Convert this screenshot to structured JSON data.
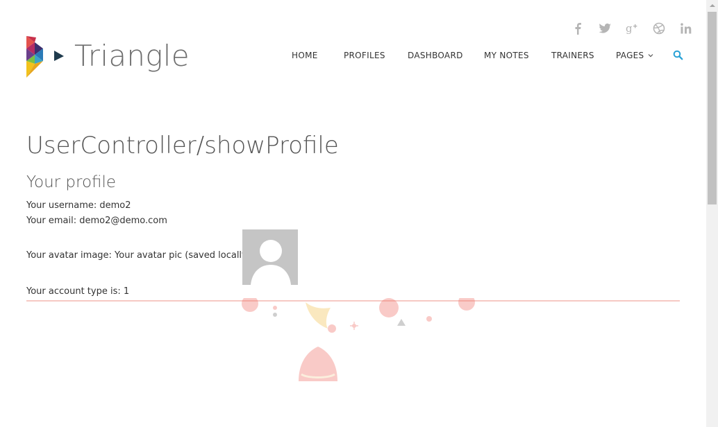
{
  "brand": {
    "name": "Triangle"
  },
  "social": [
    {
      "icon": "facebook-icon",
      "glyph": "f"
    },
    {
      "icon": "twitter-icon",
      "glyph": "twitter"
    },
    {
      "icon": "google-plus-icon",
      "glyph": "g+"
    },
    {
      "icon": "dribbble-icon",
      "glyph": "dribbble"
    },
    {
      "icon": "linkedin-icon",
      "glyph": "in"
    }
  ],
  "nav": {
    "items": [
      {
        "label": "HOME"
      },
      {
        "label": "PROFILES"
      },
      {
        "label": "DASHBOARD"
      },
      {
        "label": "MY NOTES"
      },
      {
        "label": "TRAINERS"
      },
      {
        "label": "PAGES"
      }
    ],
    "search_icon": "search-icon"
  },
  "content": {
    "page_title": "UserController/showProfile",
    "section_title": "Your profile",
    "username_line": "Your username: demo2",
    "email_line": "Your email: demo2@demo.com",
    "avatar_line": "Your avatar image: Your avatar pic (saved locally):",
    "account_line": "Your account type is: 1"
  },
  "colors": {
    "accent": "#2aa2d6",
    "divider": "#f6c9c3",
    "social_icons": "#b5b5b5"
  }
}
